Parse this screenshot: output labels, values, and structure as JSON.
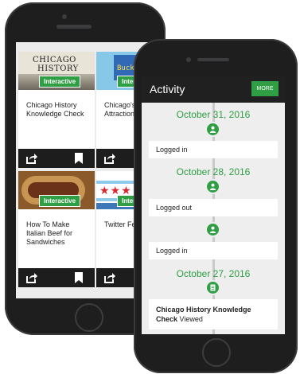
{
  "back_phone": {
    "cards": [
      {
        "image_text": [
          "CHICAGO",
          "HISTORY"
        ],
        "badge": "Interactive",
        "title": "Chicago History Knowledge Check"
      },
      {
        "image_text": [
          "Buck"
        ],
        "badge": "Inter",
        "title": "Chicago's Tourist Attraction"
      },
      {
        "badge": "Interactive",
        "title": "How To Make Italian Beef for Sandwiches"
      },
      {
        "badge": "Inter",
        "title": "Twitter Fe"
      }
    ]
  },
  "front_phone": {
    "header": {
      "title": "Activity",
      "more_label": "MORE"
    },
    "timeline": [
      {
        "date": "October 31, 2016"
      },
      {
        "entry": "Logged in"
      },
      {
        "date": "October 28, 2016"
      },
      {
        "entry": "Logged out"
      },
      {
        "entry": "Logged in"
      },
      {
        "date": "October 27, 2016"
      },
      {
        "entry_bold": "Chicago History Knowledge Check",
        "entry_suffix": " Viewed"
      }
    ]
  },
  "colors": {
    "accent": "#2f9e44",
    "header_bg": "#202020",
    "phone_body": "#1e1e1f"
  },
  "icons": [
    "share-icon",
    "bookmark-icon",
    "user-icon",
    "document-icon"
  ]
}
